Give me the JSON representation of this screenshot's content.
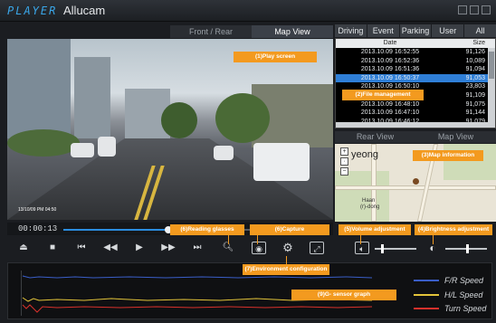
{
  "window": {
    "brand_player": "PLAYER",
    "brand_name": "Allucam"
  },
  "view_tabs": [
    {
      "label": "Front / Rear",
      "active": false
    },
    {
      "label": "Map View",
      "active": true
    }
  ],
  "list_tabs": [
    "Driving",
    "Event",
    "Parking",
    "User",
    "All"
  ],
  "file_list": {
    "headers": [
      "Date",
      "Size"
    ],
    "rows": [
      {
        "date": "2013.10.09 16:52:55",
        "size": "91,126"
      },
      {
        "date": "2013.10.09 16:52:36",
        "size": "10,089"
      },
      {
        "date": "2013.10.09 16:51:36",
        "size": "91,094"
      },
      {
        "date": "2013.10.09 16:50:37",
        "size": "91,053",
        "selected": true
      },
      {
        "date": "2013.10.09 16:50:10",
        "size": "23,803"
      },
      {
        "date": "2013.10.09 16:49:10",
        "size": "91,109"
      },
      {
        "date": "2013.10.09 16:48:10",
        "size": "91,075"
      },
      {
        "date": "2013.10.09 16:47:10",
        "size": "91,144"
      },
      {
        "date": "2013.10.09 16:46:12",
        "size": "91,079"
      }
    ]
  },
  "rear_map_tabs": [
    "Rear View",
    "Map View"
  ],
  "map": {
    "area_label": "yeong",
    "label_1": "Haan",
    "label_2": "(r)-dong"
  },
  "video": {
    "overlay_text": "13/10/09 PM 04:50"
  },
  "timeline": {
    "time": "00:00:13",
    "progress": 0.4
  },
  "sliders": {
    "volume": 0.15,
    "brightness": 0.5
  },
  "graph": {
    "legend": [
      {
        "label": "F/R Speed",
        "color": "#3a5ec8"
      },
      {
        "label": "H/L Speed",
        "color": "#e3c43a"
      },
      {
        "label": "Turn Speed",
        "color": "#d8312c"
      }
    ]
  },
  "callouts": {
    "play_screen": "(1)Play screen",
    "file_management": "(2)File management",
    "map_information": "(3)Map information",
    "brightness": "(4)Brightness adjustment",
    "volume": "(5)Volume adjustment",
    "reading_glasses": "(6)Reading glasses",
    "capture": "(6)Capture",
    "environment": "(7)Environment configuration",
    "gsensor": "(9)G- sensor graph"
  },
  "icons": [
    "eject-icon",
    "stop-icon",
    "first-icon",
    "rewind-icon",
    "play-icon",
    "fast-forward-icon",
    "last-icon",
    "magnifier-icon",
    "camera-icon",
    "gear-icon",
    "fullscreen-icon",
    "speaker-icon",
    "brightness-icon"
  ]
}
